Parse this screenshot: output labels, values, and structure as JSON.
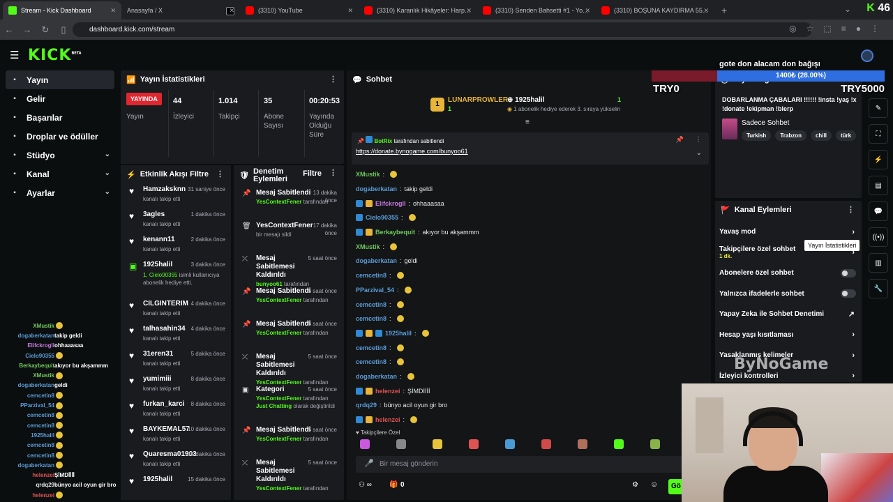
{
  "browser": {
    "tabs": [
      {
        "title": "Stream - Kick Dashboard",
        "icon": "kick-favicon",
        "active": true
      },
      {
        "title": "Anasayfa / X",
        "icon": "x-favicon"
      },
      {
        "title": "(3310) YouTube",
        "icon": "youtube-favicon"
      },
      {
        "title": "(3310) Karanlık Hikâyeler: Harp...",
        "icon": "youtube-favicon"
      },
      {
        "title": "(3310) Senden Bahsetti #1 - Yo...",
        "icon": "youtube-favicon"
      },
      {
        "title": "(3310) BOŞUNA KAYDIRMA 55...",
        "icon": "youtube-favicon"
      }
    ],
    "url": "dashboard.kick.com/stream",
    "kick_count": "46",
    "kick_letter": "K"
  },
  "topbar": {
    "logo": "KICK",
    "logo_sup": "BETA"
  },
  "sidebar": {
    "items": [
      {
        "label": "Yayın",
        "icon": "broadcast-icon",
        "active": true
      },
      {
        "label": "Gelir",
        "icon": "wallet-icon"
      },
      {
        "label": "Başarılar",
        "icon": "trophy-icon"
      },
      {
        "label": "Droplar ve ödüller",
        "icon": "gift-icon"
      },
      {
        "label": "Stüdyo",
        "icon": "grid-icon",
        "expandable": true
      },
      {
        "label": "Kanal",
        "icon": "chart-icon",
        "expandable": true
      },
      {
        "label": "Ayarlar",
        "icon": "gear-icon",
        "expandable": true
      }
    ]
  },
  "stream_overlay_chat": [
    {
      "user": "XMustik",
      "msg": "",
      "color": "#70c95c"
    },
    {
      "user": "dogaberkatan",
      "msg": "takip geldi",
      "color": "#5b9bd5"
    },
    {
      "user": "Elifckrogll",
      "msg": "ohhaaasaa",
      "color": "#c97be0"
    },
    {
      "user": "Cielo90355",
      "msg": "",
      "color": "#5b9bd5"
    },
    {
      "user": "Berkaybequit",
      "msg": "akıyor bu akşammm",
      "color": "#70c95c"
    },
    {
      "user": "XMustik",
      "msg": "",
      "color": "#70c95c"
    },
    {
      "user": "dogaberkatan",
      "msg": "geldi",
      "color": "#5b9bd5"
    },
    {
      "user": "cemcetin8",
      "msg": "",
      "color": "#5b9bd5"
    },
    {
      "user": "PParzival_54",
      "msg": "",
      "color": "#5b9bd5"
    },
    {
      "user": "cemcetin8",
      "msg": "",
      "color": "#5b9bd5"
    },
    {
      "user": "cemcetin8",
      "msg": "",
      "color": "#5b9bd5"
    },
    {
      "user": "1925halil",
      "msg": "",
      "color": "#5b9bd5"
    },
    {
      "user": "cemcetin8",
      "msg": "",
      "color": "#5b9bd5"
    },
    {
      "user": "cemcetin8",
      "msg": "",
      "color": "#5b9bd5"
    },
    {
      "user": "dogaberkatan",
      "msg": "",
      "color": "#5b9bd5"
    },
    {
      "user": "helenzei",
      "msg": "ŞİMDİİİİ",
      "color": "#e05252"
    },
    {
      "user": "qrdq29",
      "msg": "bünyo acil oyun gir bro",
      "color": "#e8e8e8"
    },
    {
      "user": "helenzei",
      "msg": "",
      "color": "#e05252"
    }
  ],
  "stats": {
    "title": "Yayın İstatistikleri",
    "live_badge": "YAYINDA",
    "live_label": "Yayın",
    "viewers_val": "44",
    "viewers_lbl": "İzleyici",
    "followers_val": "1.014",
    "followers_lbl": "Takipçi",
    "subs_val": "35",
    "subs_lbl": "Abone Sayısı",
    "uptime_val": "00:20:53",
    "uptime_lbl": "Yayında Olduğu Süre"
  },
  "events": {
    "title": "Etkinlik Akışı",
    "filter": "Filtre",
    "items": [
      {
        "name": "Hamzaksknn",
        "time": "31 saniye önce",
        "sub": "kanalı takip etti"
      },
      {
        "name": "3agles",
        "time": "1 dakika önce",
        "sub": "kanalı takip etti"
      },
      {
        "name": "kenann11",
        "time": "2 dakika önce",
        "sub": "kanalı takip etti"
      },
      {
        "name": "1925halil",
        "time": "3 dakika önce",
        "gift": "1, Cielo90355",
        "sub": "isimli kullanıcıya abonelik hediye etti.",
        "tall": true
      },
      {
        "name": "CILGINTERIM",
        "time": "4 dakika önce",
        "sub": "kanalı takip etti"
      },
      {
        "name": "talhasahin34",
        "time": "4 dakika önce",
        "sub": "kanalı takip etti"
      },
      {
        "name": "31eren31",
        "time": "5 dakika önce",
        "sub": "kanalı takip etti"
      },
      {
        "name": "yumimiii",
        "time": "8 dakika önce",
        "sub": "kanalı takip etti"
      },
      {
        "name": "furkan_karci",
        "time": "8 dakika önce",
        "sub": "kanalı takip etti"
      },
      {
        "name": "BAYKEMAL57",
        "time": "10 dakika önce",
        "sub": "kanalı takip etti"
      },
      {
        "name": "Quaresma01903",
        "time": "15 dakika önce",
        "sub": "kanalı takip etti"
      },
      {
        "name": "1925halil",
        "time": "15 dakika önce",
        "sub": ""
      }
    ]
  },
  "mod": {
    "title": "Denetim Eylemleri",
    "filter": "Filtre",
    "items": [
      {
        "icon": "pin-icon",
        "name": "Mesaj Sabitlendi",
        "time": "13 dakika önce",
        "by": "YesContextFener",
        "suffix": "tarafından"
      },
      {
        "icon": "trash-icon",
        "name": "YesContextFener",
        "time": "17 dakika önce",
        "by": "",
        "suffix": "bir mesajı sildi"
      },
      {
        "icon": "unpin-icon",
        "name": "Mesaj Sabitlemesi Kaldırıldı",
        "time": "5 saat önce",
        "by": "bunyoo61",
        "suffix": "tarafından"
      },
      {
        "icon": "pin-icon",
        "name": "Mesaj Sabitlendi",
        "time": "5 saat önce",
        "by": "YesContextFener",
        "suffix": "tarafından"
      },
      {
        "icon": "pin-icon",
        "name": "Mesaj Sabitlendi",
        "time": "5 saat önce",
        "by": "YesContextFener",
        "suffix": "tarafından"
      },
      {
        "icon": "unpin-icon",
        "name": "Mesaj Sabitlemesi Kaldırıldı",
        "time": "5 saat önce",
        "by": "YesContextFener",
        "suffix": "tarafından"
      },
      {
        "icon": "category-icon",
        "name": "Kategori",
        "time": "5 saat önce",
        "by": "YesContextFener",
        "suffix": "tarafından",
        "extra": "Just Chatting",
        "extra2": "olarak değiştirildi"
      },
      {
        "icon": "pin-icon",
        "name": "Mesaj Sabitlendi",
        "time": "5 saat önce",
        "by": "YesContextFener",
        "suffix": "tarafından"
      },
      {
        "icon": "unpin-icon",
        "name": "Mesaj Sabitlemesi Kaldırıldı",
        "time": "5 saat önce",
        "by": "YesContextFener",
        "suffix": "tarafından"
      }
    ]
  },
  "chat": {
    "title": "Sohbet",
    "goal_user": "LUNARPROWLER",
    "goal_user_count": "1",
    "goal_user2": "1925halil",
    "goal_user2_count": "1",
    "goal_text": "1 abonelik hediye ederek 3. sıraya yükselin",
    "pinned_by": "BotRix",
    "pinned_suffix": "tarafından sabitlendi",
    "pinned_link": "https://donate.bynogame.com/bunyoo61",
    "messages": [
      {
        "user": "XMustik",
        "text": "",
        "color": "#70c95c",
        "emote": true
      },
      {
        "user": "dogaberkatan",
        "text": "takip geldi",
        "color": "#5b9bd5"
      },
      {
        "user": "Elifckrogll",
        "text": "ohhaaasaa",
        "color": "#c97be0",
        "badges": 2
      },
      {
        "user": "Cielo90355",
        "text": "",
        "color": "#5b9bd5",
        "badges": 1,
        "emote": true
      },
      {
        "user": "Berkaybequit",
        "text": "akıyor bu akşammm",
        "color": "#70c95c",
        "badges": 2
      },
      {
        "user": "XMustik",
        "text": "",
        "color": "#70c95c",
        "emote": true
      },
      {
        "user": "dogaberkatan",
        "text": "geldi",
        "color": "#5b9bd5"
      },
      {
        "user": "cemcetin8",
        "text": "",
        "color": "#5b9bd5",
        "emote": true
      },
      {
        "user": "PParzival_54",
        "text": "",
        "color": "#5b9bd5",
        "emote": true
      },
      {
        "user": "cemcetin8",
        "text": "",
        "color": "#5b9bd5",
        "emote": true
      },
      {
        "user": "cemcetin8",
        "text": "",
        "color": "#5b9bd5",
        "emote": true
      },
      {
        "user": "1925halil",
        "text": "",
        "color": "#5b9bd5",
        "badges": 3,
        "emote": true
      },
      {
        "user": "cemcetin8",
        "text": "",
        "color": "#5b9bd5",
        "emote": true
      },
      {
        "user": "cemcetin8",
        "text": "",
        "color": "#5b9bd5",
        "emote": true
      },
      {
        "user": "dogaberkatan",
        "text": "",
        "color": "#5b9bd5",
        "emote": true
      },
      {
        "user": "helenzei",
        "text": "ŞİMDİİİİ",
        "color": "#e05252",
        "badges": 2
      },
      {
        "user": "qrdq29",
        "text": "bünyo acil oyun gir bro",
        "color": "#5b9bd5"
      },
      {
        "user": "helenzei",
        "text": "",
        "color": "#e05252",
        "badges": 2,
        "emote": true
      }
    ],
    "followers_only": "Takipçilere Özel",
    "input_placeholder": "Bir mesaj gönderin",
    "footer_count": "0",
    "send_label": "Gö"
  },
  "info": {
    "title": "Yayın Bilgisi",
    "stream_title": "DOBARLANMA ÇABALARI !!!!!! !insta !yaş !x !donate !ekipman !blerp",
    "category": "Sadece Sohbet",
    "tags": [
      "Turkish",
      "Trabzon",
      "chill",
      "türk"
    ]
  },
  "actions": {
    "title": "Kanal Eylemleri",
    "items": [
      {
        "label": "Yavaş mod",
        "type": "chevron"
      },
      {
        "label": "Takipçilere özel sohbet",
        "type": "chevron",
        "sub": "1 dk."
      },
      {
        "label": "Abonelere özel sohbet",
        "type": "toggle"
      },
      {
        "label": "Yalnızca ifadelerle sohbet",
        "type": "toggle"
      },
      {
        "label": "Yapay Zeka ile Sohbet Denetimi",
        "type": "external"
      },
      {
        "label": "Hesap yaşı kısıtlaması",
        "type": "chevron"
      },
      {
        "label": "Yasaklanmış kelimeler",
        "type": "chevron"
      },
      {
        "label": "İzleyici kontrolleri",
        "type": "chevron"
      }
    ]
  },
  "tooltip": "Yayın İstatistikleri",
  "overlay": {
    "donation_title": "gote don alacam don bağışı",
    "donation_progress": "1400₺ (28.00%)",
    "donation_fraction": 0.28,
    "left_amount": "TRY0",
    "right_amount": "TRY5000",
    "sponsor": "ByNoGame"
  },
  "colors": {
    "kick_green": "#53fc18",
    "live_red": "#e0262e",
    "panel": "#191b1f"
  }
}
